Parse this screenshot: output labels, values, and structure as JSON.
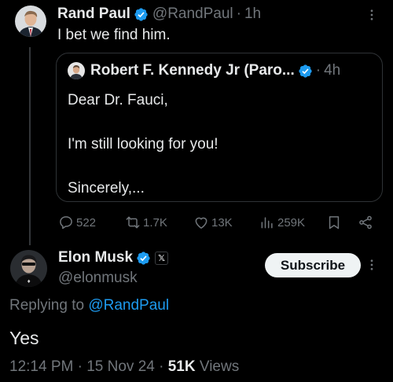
{
  "colors": {
    "background": "#000000",
    "text": "#e7e9ea",
    "muted": "#71767b",
    "link": "#1d9bf0",
    "verified": "#1d9bf0",
    "border": "#2f3336"
  },
  "tweet": {
    "author_name": "Rand Paul",
    "handle": "@RandPaul",
    "time": "1h",
    "text": "I bet we find him.",
    "verified_icon": "verified-badge-icon",
    "quote": {
      "author_name": "Robert F. Kennedy Jr (Paro...",
      "time": "4h",
      "text": "Dear Dr. Fauci,\n\nI'm still looking for you!\n\nSincerely,..."
    },
    "actions": {
      "replies": "522",
      "reposts": "1.7K",
      "likes": "13K",
      "views": "259K"
    }
  },
  "reply": {
    "author_name": "Elon Musk",
    "handle": "@elonmusk",
    "badge": "𝕏",
    "subscribe_label": "Subscribe",
    "replying_prefix": "Replying to",
    "replying_to": "@RandPaul",
    "text": "Yes",
    "time": "12:14 PM",
    "date": "15 Nov 24",
    "views_count": "51K",
    "views_label": "Views"
  }
}
